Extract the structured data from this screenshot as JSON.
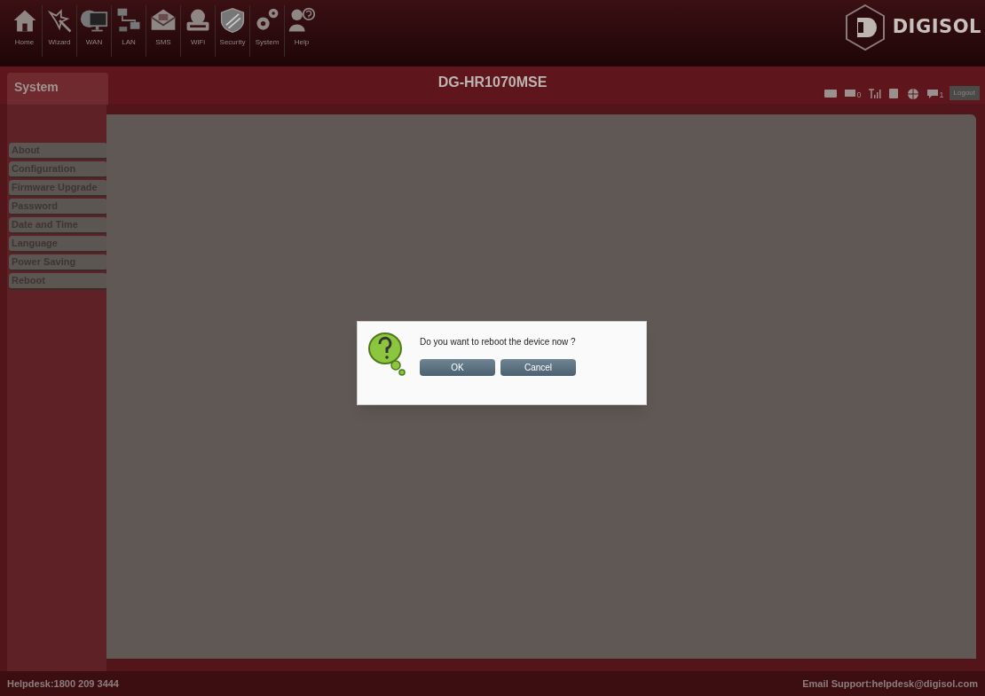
{
  "nav": [
    {
      "label": "Home",
      "kind": "home"
    },
    {
      "label": "Wizard",
      "kind": "wand"
    },
    {
      "label": "WAN",
      "kind": "monitor"
    },
    {
      "label": "LAN",
      "kind": "network"
    },
    {
      "label": "SMS",
      "kind": "mail"
    },
    {
      "label": "WiFi",
      "kind": "router"
    },
    {
      "label": "Security",
      "kind": "shield"
    },
    {
      "label": "System",
      "kind": "gears"
    },
    {
      "label": "Help",
      "kind": "help"
    }
  ],
  "logo": "DIGISOL",
  "section_tab": "System",
  "device_title": "DG-HR1070MSE",
  "status_icons": [
    {
      "kind": "sim"
    },
    {
      "kind": "message",
      "count": "0"
    },
    {
      "kind": "signal"
    },
    {
      "kind": "device"
    },
    {
      "kind": "globe"
    },
    {
      "kind": "chat",
      "count": "1"
    }
  ],
  "logout": "Logout",
  "sidebar": {
    "items": [
      {
        "label": "About",
        "selected": false
      },
      {
        "label": "Configuration",
        "selected": false
      },
      {
        "label": "Firmware Upgrade",
        "selected": false
      },
      {
        "label": "Password",
        "selected": false
      },
      {
        "label": "Date and Time",
        "selected": false
      },
      {
        "label": "Language",
        "selected": false
      },
      {
        "label": "Power Saving",
        "selected": false
      },
      {
        "label": "Reboot",
        "selected": false
      }
    ]
  },
  "dialog": {
    "message": "Do you want to reboot the device now ?",
    "buttons": [
      "OK",
      "Cancel"
    ]
  },
  "footer": {
    "helpdesk": "Helpdesk:1800 209 3444",
    "email": "Email Support:helpdesk@digisol.com"
  }
}
